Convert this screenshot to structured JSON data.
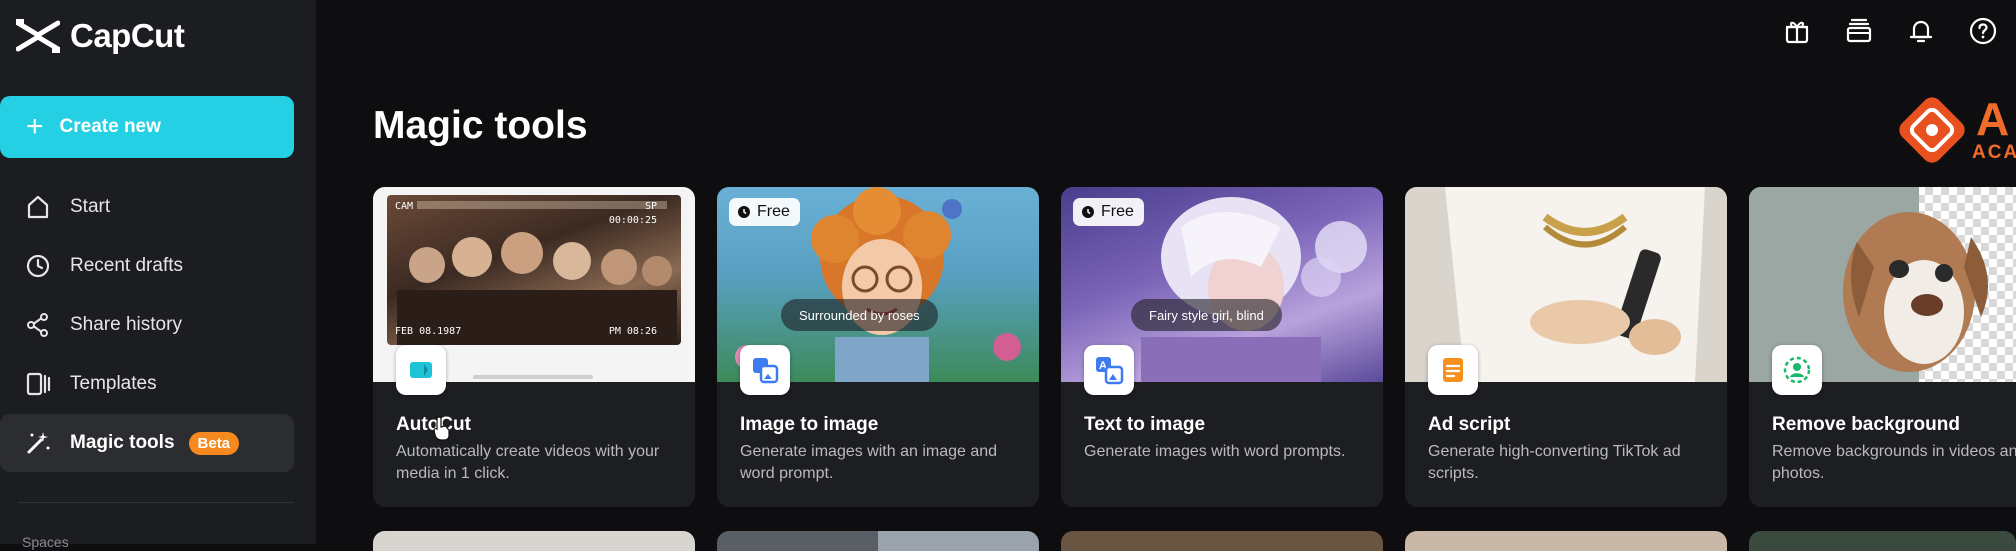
{
  "app": {
    "name": "CapCut"
  },
  "sidebar": {
    "create_label": "Create new",
    "items": [
      {
        "label": "Start",
        "icon": "home-icon"
      },
      {
        "label": "Recent drafts",
        "icon": "clock-icon"
      },
      {
        "label": "Share history",
        "icon": "share-icon"
      },
      {
        "label": "Templates",
        "icon": "templates-icon"
      },
      {
        "label": "Magic tools",
        "icon": "magic-wand-icon",
        "badge": "Beta",
        "active": true
      }
    ],
    "section_label": "Spaces"
  },
  "header": {
    "icons": [
      "gift-icon",
      "stack-icon",
      "bell-icon",
      "help-icon"
    ]
  },
  "main": {
    "title": "Magic tools",
    "brand": {
      "text_main": "A",
      "text_sub": "ACA"
    },
    "cards": [
      {
        "name": "AutoCut",
        "desc": "Automatically create videos with your media in 1 click.",
        "icon": "autocut-icon",
        "thumb_top_left": "CAM",
        "thumb_top_right": "SP",
        "thumb_time_top": "00:00:25",
        "thumb_date": "FEB 08.1987",
        "thumb_time_bottom": "PM 08:26"
      },
      {
        "name": "Image to image",
        "desc": "Generate images with an image and word prompt.",
        "icon": "image-to-image-icon",
        "badge": "Free",
        "caption": "Surrounded by roses"
      },
      {
        "name": "Text to image",
        "desc": "Generate images with word prompts.",
        "icon": "text-to-image-icon",
        "badge": "Free",
        "caption": "Fairy style girl, blind"
      },
      {
        "name": "Ad script",
        "desc": "Generate high-converting TikTok ad scripts.",
        "icon": "ad-script-icon"
      },
      {
        "name": "Remove background",
        "desc": "Remove backgrounds in videos and photos.",
        "icon": "remove-background-icon"
      }
    ]
  },
  "colors": {
    "accent": "#25d0e4",
    "beta_badge": "#f68a1e",
    "sidebar_bg": "#1c1d20",
    "page_bg": "#0e0e10",
    "card_bg": "#1d1e22"
  }
}
